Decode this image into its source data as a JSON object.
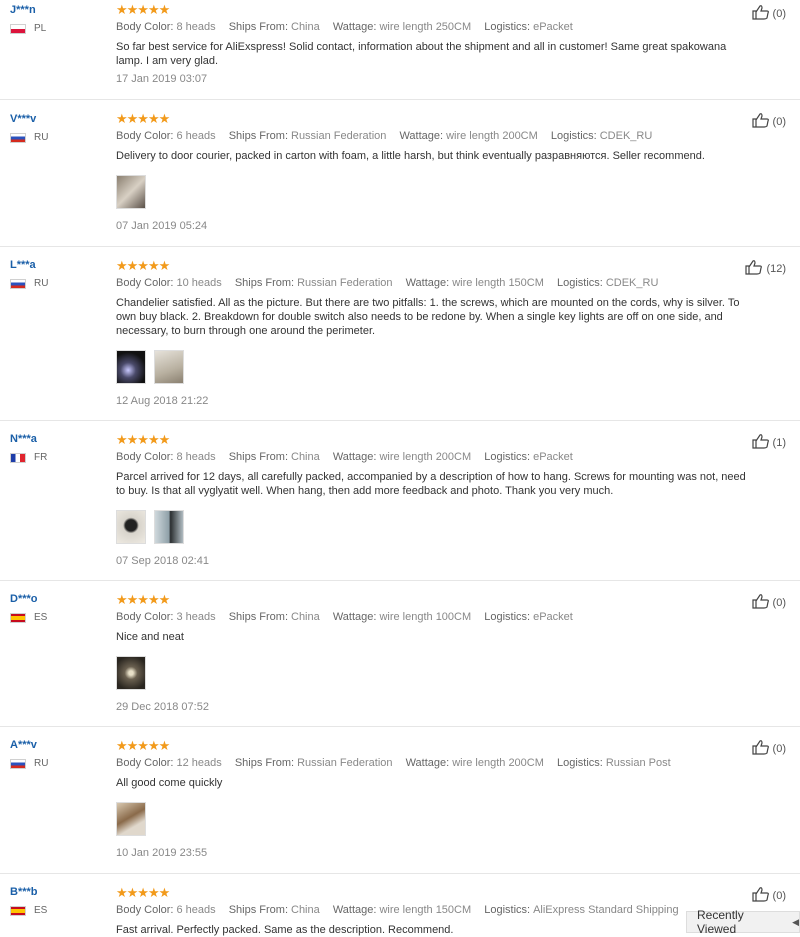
{
  "stars": "★★★★★",
  "labels": {
    "body_color": "Body Color:",
    "ships_from": "Ships From:",
    "wattage": "Wattage:",
    "logistics": "Logistics:"
  },
  "reviews": [
    {
      "user": "J***n",
      "country": "PL",
      "flag": "pl",
      "body_color": "8 heads",
      "ships_from": "China",
      "wattage": "wire length 250CM",
      "logistics": "ePacket",
      "text": "So far best service for AliExspress! Solid contact, information about the shipment and all in customer! Same great spakowana lamp. I am very glad.",
      "date": "17 Jan 2019 03:07",
      "helpful": "(0)"
    },
    {
      "user": "V***v",
      "country": "RU",
      "flag": "ru",
      "body_color": "6 heads",
      "ships_from": "Russian Federation",
      "wattage": "wire length 200CM",
      "logistics": "CDEK_RU",
      "text": "Delivery to door courier, packed in carton with foam, a little harsh, but think eventually разравняются. Seller recommend.",
      "date": "07 Jan 2019 05:24",
      "helpful": "(0)"
    },
    {
      "user": "L***a",
      "country": "RU",
      "flag": "ru",
      "body_color": "10 heads",
      "ships_from": "Russian Federation",
      "wattage": "wire length 150CM",
      "logistics": "CDEK_RU",
      "text": "Chandelier satisfied. All as the picture. But there are two pitfalls: 1. the screws, which are mounted on the cords, why is silver. To own buy black. 2. Breakdown for double switch also needs to be redone by. When a single key lights are off on one side, and necessary, to burn through one around the perimeter.",
      "date": "12 Aug 2018 21:22",
      "helpful": "(12)"
    },
    {
      "user": "N***a",
      "country": "FR",
      "flag": "fr",
      "body_color": "8 heads",
      "ships_from": "China",
      "wattage": "wire length 200CM",
      "logistics": "ePacket",
      "text": "Parcel arrived for 12 days, all carefully packed, accompanied by a description of how to hang. Screws for mounting was not, need to buy. Is that all vyglyatit well. When hang, then add more feedback and photo. Thank you very much.",
      "date": "07 Sep 2018 02:41",
      "helpful": "(1)"
    },
    {
      "user": "D***o",
      "country": "ES",
      "flag": "es",
      "body_color": "3 heads",
      "ships_from": "China",
      "wattage": "wire length 100CM",
      "logistics": "ePacket",
      "text": "Nice and neat",
      "date": "29 Dec 2018 07:52",
      "helpful": "(0)"
    },
    {
      "user": "A***v",
      "country": "RU",
      "flag": "ru",
      "body_color": "12 heads",
      "ships_from": "Russian Federation",
      "wattage": "wire length 200CM",
      "logistics": "Russian Post",
      "text": "All good come quickly",
      "date": "10 Jan 2019 23:55",
      "helpful": "(0)"
    },
    {
      "user": "B***b",
      "country": "ES",
      "flag": "es",
      "body_color": "6 heads",
      "ships_from": "China",
      "wattage": "wire length 150CM",
      "logistics": "AliExpress Standard Shipping",
      "text": "Fast arrival. Perfectly packed. Same as the description. Recommend.",
      "date": "",
      "helpful": "(0)"
    }
  ],
  "recently_viewed": "Recently Viewed"
}
